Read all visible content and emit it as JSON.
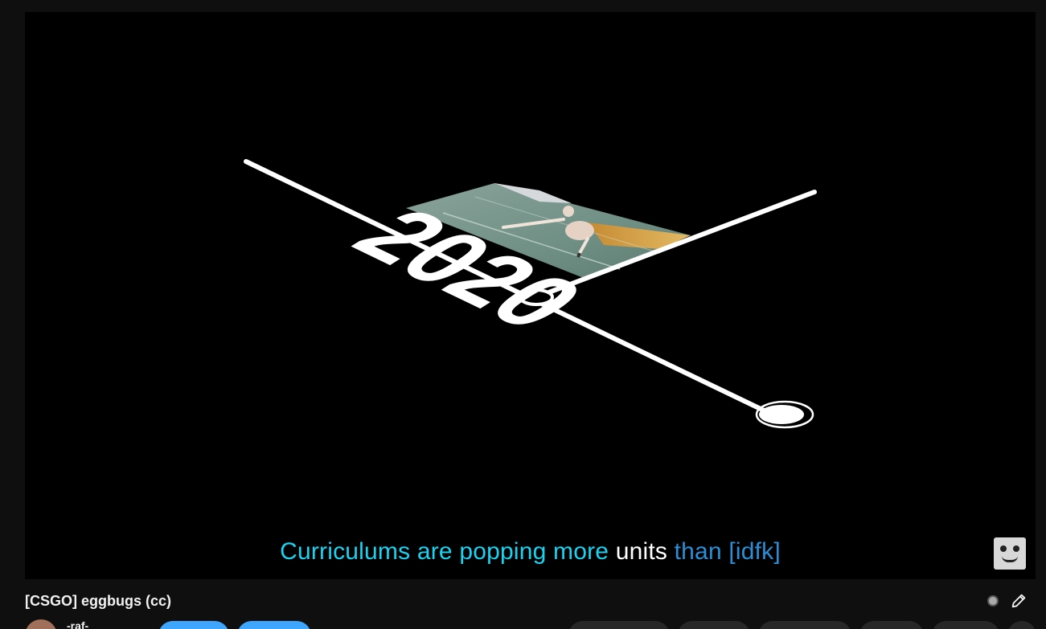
{
  "video": {
    "overlay_year": "2020",
    "subtitle": {
      "parts": [
        {
          "text": "Curriculums are popping more ",
          "color": "#19d3f0"
        },
        {
          "text": "units ",
          "color": "#ffffff"
        },
        {
          "text": "than [idfk]",
          "color": "#2a8fd6"
        }
      ]
    }
  },
  "info": {
    "title": "[CSGO] eggbugs (cc)",
    "channel_name": "-raf-"
  },
  "colors": {
    "page_background": "#0f0f0f",
    "video_background": "#000000",
    "subscribe_accent": "#3ea6ff",
    "button_gray": "#272727"
  }
}
